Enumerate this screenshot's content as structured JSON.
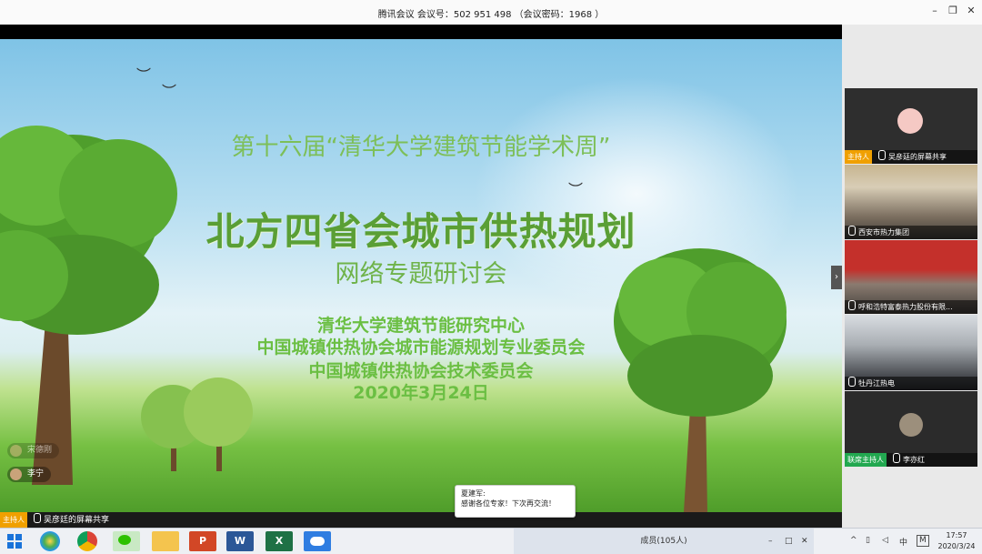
{
  "window": {
    "title": "腾讯会议 会议号：502 951 498 （会议密码：1968 ）",
    "minimize_glyph": "–",
    "restore_glyph": "❐",
    "close_glyph": "✕"
  },
  "slide": {
    "subtitle": "第十六届“清华大学建筑节能学术周”",
    "main_title": "北方四省会城市供热规划",
    "topic": "网络专题研讨会",
    "orgs": [
      "清华大学建筑节能研究中心",
      "中国城镇供热协会城市能源规划专业委员会",
      "中国城镇供热协会技术委员会"
    ],
    "date": "2020年3月24日"
  },
  "overlay_participants": [
    "宋德刚",
    "李宁"
  ],
  "sidebar": {
    "host_badge": "主持人",
    "cohost_badge": "联席主持人",
    "tiles": [
      {
        "label": "吴彦廷的屏幕共享"
      },
      {
        "label": "西安市热力集团"
      },
      {
        "label": "呼和浩特富泰热力股份有限..."
      },
      {
        "label": "牡丹江热电"
      },
      {
        "label": "李亦红"
      }
    ]
  },
  "share_bar": {
    "host_badge": "主持人",
    "label": "吴彦廷的屏幕共享"
  },
  "chat": {
    "sender": "夏建军:",
    "message": "感谢各位专家！下次再交流！"
  },
  "taskbar": {
    "members": "成员(105人)",
    "members_controls": [
      "–",
      "□",
      "✕"
    ],
    "ime": "中",
    "m_key": "M",
    "time": "17:57",
    "date": "2020/3/24"
  },
  "colors": {
    "slide_green": "#5a9f35",
    "host_orange": "#f0a000",
    "cohost_green": "#22a850"
  }
}
